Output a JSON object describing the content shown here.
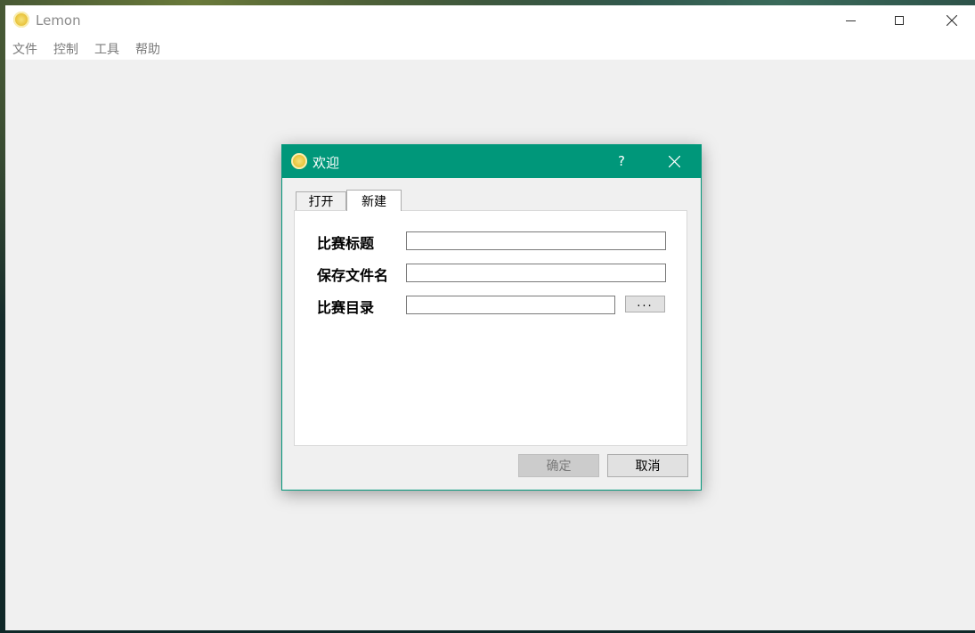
{
  "app": {
    "title": "Lemon",
    "menu": [
      "文件",
      "控制",
      "工具",
      "帮助"
    ]
  },
  "dialog": {
    "title": "欢迎",
    "help": "?",
    "tabs": [
      "打开",
      "新建"
    ],
    "active_tab": "新建",
    "fields": {
      "contest_title_label": "比赛标题",
      "contest_title_value": "",
      "save_filename_label": "保存文件名",
      "save_filename_value": "",
      "contest_dir_label": "比赛目录",
      "contest_dir_value": ""
    },
    "browse_label": "...",
    "ok_label": "确定",
    "cancel_label": "取消"
  },
  "colors": {
    "accent": "#00977a",
    "window_bg": "#f0f0f0"
  },
  "icons": {
    "app": "lemon-icon",
    "minimize": "minimize-icon",
    "maximize": "maximize-icon",
    "close": "close-icon",
    "help": "help-icon"
  }
}
